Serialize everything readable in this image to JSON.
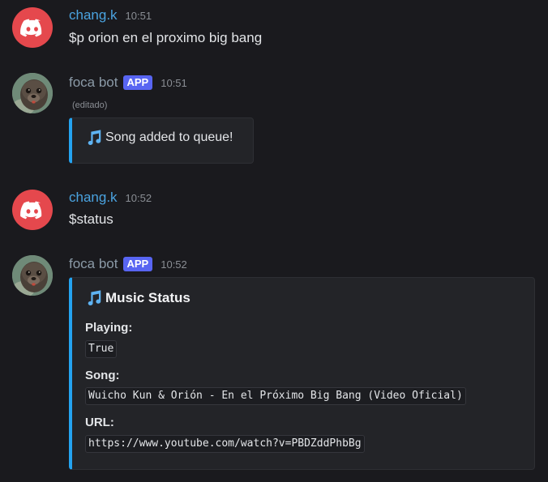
{
  "messages": [
    {
      "author": "chang.k",
      "time": "10:51",
      "text": "$p orion en el proximo big bang"
    },
    {
      "author": "foca bot",
      "badge": "APP",
      "time": "10:51",
      "edited": "(editado)",
      "embed_text": "Song added to queue!"
    },
    {
      "author": "chang.k",
      "time": "10:52",
      "text": "$status"
    },
    {
      "author": "foca bot",
      "badge": "APP",
      "time": "10:52",
      "embed": {
        "title": "Music Status",
        "fields": [
          {
            "name": "Playing:",
            "value": "True"
          },
          {
            "name": "Song:",
            "value": "Wuicho Kun & Orión - En el Próximo Big Bang (Video Oficial)"
          },
          {
            "name": "URL:",
            "value": "https://www.youtube.com/watch?v=PBDZddPhbBg"
          }
        ]
      }
    }
  ],
  "colors": {
    "user_name": "#4aa3e0",
    "bot_name": "#8b9aa7",
    "app_badge": "#5865f2",
    "embed_border": "#24a3f0",
    "discord_avatar": "#e5484d"
  },
  "icons": {
    "user_avatar": "discord-logo-icon",
    "bot_avatar": "seal-avatar",
    "embed_icon": "musical-note-icon"
  }
}
